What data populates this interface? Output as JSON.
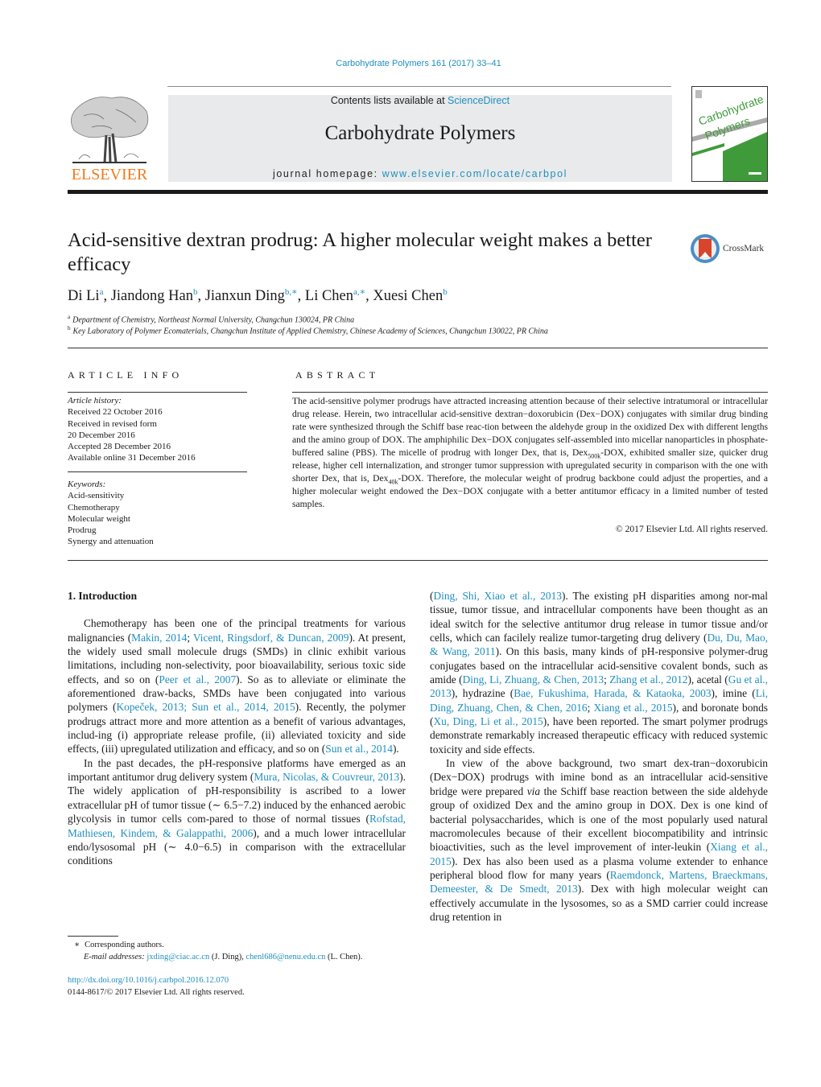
{
  "header": {
    "journal_ref": "Carbohydrate Polymers 161 (2017) 33–41",
    "contents_prefix": "Contents lists available at ",
    "contents_link": "ScienceDirect",
    "journal_name": "Carbohydrate Polymers",
    "homepage_prefix": "journal homepage: ",
    "homepage_link": "www.elsevier.com/locate/carbpol",
    "publisher_logo": "ELSEVIER",
    "cover": {
      "line1": "Carbohydrate",
      "line2": "Polymers"
    },
    "colors": {
      "link": "#1f8fbf",
      "elsevier_orange": "#f07b1a",
      "cover_green": "#3f9b3a",
      "banner_gray": "#e9eaeb"
    }
  },
  "title": "Acid-sensitive dextran prodrug: A higher molecular weight makes a better efficacy",
  "crossmark_label": "CrossMark",
  "authors": [
    {
      "name": "Di Li",
      "sup": "a"
    },
    {
      "name": "Jiandong Han",
      "sup": "b"
    },
    {
      "name": "Jianxun Ding",
      "sup": "b,∗"
    },
    {
      "name": "Li Chen",
      "sup": "a,∗"
    },
    {
      "name": "Xuesi Chen",
      "sup": "b"
    }
  ],
  "affiliations": [
    {
      "key": "a",
      "text": "Department of Chemistry, Northeast Normal University, Changchun 130024, PR China"
    },
    {
      "key": "b",
      "text": "Key Laboratory of Polymer Ecomaterials, Changchun Institute of Applied Chemistry, Chinese Academy of Sciences, Changchun 130022, PR China"
    }
  ],
  "article_info": {
    "heading": "ARTICLE INFO",
    "history_label": "Article history:",
    "history": [
      "Received 22 October 2016",
      "Received in revised form",
      "20 December 2016",
      "Accepted 28 December 2016",
      "Available online 31 December 2016"
    ],
    "keywords_label": "Keywords:",
    "keywords": [
      "Acid-sensitivity",
      "Chemotherapy",
      "Molecular weight",
      "Prodrug",
      "Synergy and attenuation"
    ]
  },
  "abstract": {
    "heading": "ABSTRACT",
    "part1": "The acid-sensitive polymer prodrugs have attracted increasing attention because of their selective intratumoral or intracellular drug release. Herein, two intracellular acid-sensitive dextran−doxorubicin (Dex−DOX) conjugates with similar drug binding rate were synthesized through the Schiff base reac-tion between the aldehyde group in the oxidized Dex with different lengths and the amino group of DOX. The amphiphilic Dex−DOX conjugates self-assembled into micellar nanoparticles in phosphate-buffered saline (PBS). The micelle of prodrug with longer Dex, that is, Dex",
    "sub1": "500k",
    "part2": "-DOX, exhibited smaller size, quicker drug release, higher cell internalization, and stronger tumor suppression with upregulated security in comparison with the one with shorter Dex, that is, Dex",
    "sub2": "40k",
    "part3": "-DOX. Therefore, the molecular weight of prodrug backbone could adjust the properties, and a higher molecular weight endowed the Dex−DOX conjugate with a better antitumor efficacy in a limited number of tested samples.",
    "copyright": "© 2017 Elsevier Ltd. All rights reserved."
  },
  "body": {
    "section_heading": "1.  Introduction",
    "p1": [
      {
        "t": "Chemotherapy has been one of the principal treatments for various malignancies ("
      },
      {
        "l": "Makin, 2014"
      },
      {
        "t": "; "
      },
      {
        "l": "Vicent, Ringsdorf, & Duncan, 2009"
      },
      {
        "t": "). At present, the widely used small molecule drugs (SMDs) in clinic exhibit various limitations, including non-selectivity, poor bioavailability, serious toxic side effects, and so on ("
      },
      {
        "l": "Peer et al., 2007"
      },
      {
        "t": "). So as to alleviate or eliminate the aforementioned draw-backs, SMDs have been conjugated into various polymers ("
      },
      {
        "l": "Kopeček, 2013; Sun et al., 2014, 2015"
      },
      {
        "t": "). Recently, the polymer prodrugs attract more and more attention as a benefit of various advantages, includ-ing (i) appropriate release profile, (ii) alleviated toxicity and side effects, (iii) upregulated utilization and efficacy, and so on ("
      },
      {
        "l": "Sun et al., 2014"
      },
      {
        "t": ")."
      }
    ],
    "p2": [
      {
        "t": "In the past decades, the pH-responsive platforms have emerged as an important antitumor drug delivery system ("
      },
      {
        "l": "Mura, Nicolas, & Couvreur, 2013"
      },
      {
        "t": "). The widely application of pH-responsibility is ascribed to a lower extracellular pH of tumor tissue (∼ 6.5−7.2) induced by the enhanced aerobic glycolysis in tumor cells com-pared to those of normal tissues ("
      },
      {
        "l": "Rofstad, Mathiesen, Kindem, & Galappathi, 2006"
      },
      {
        "t": "), and a much lower intracellular endo/lysosomal pH (∼ 4.0−6.5) in comparison with the extracellular conditions"
      }
    ],
    "p3": [
      {
        "t": "("
      },
      {
        "l": "Ding, Shi, Xiao et al., 2013"
      },
      {
        "t": "). The existing pH disparities among nor-mal tissue, tumor tissue, and intracellular components have been thought as an ideal switch for the selective antitumor drug release in tumor tissue and/or cells, which can facilely realize tumor-targeting drug delivery ("
      },
      {
        "l": "Du, Du, Mao, & Wang, 2011"
      },
      {
        "t": "). On this basis, many kinds of pH-responsive polymer-drug conjugates based on the intracellular acid-sensitive covalent bonds, such as amide ("
      },
      {
        "l": "Ding, Li, Zhuang, & Chen, 2013"
      },
      {
        "t": "; "
      },
      {
        "l": "Zhang et al., 2012"
      },
      {
        "t": "), acetal ("
      },
      {
        "l": "Gu et al., 2013"
      },
      {
        "t": "), hydrazine ("
      },
      {
        "l": "Bae, Fukushima, Harada, & Kataoka, 2003"
      },
      {
        "t": "), imine ("
      },
      {
        "l": "Li, Ding, Zhuang, Chen, & Chen, 2016"
      },
      {
        "t": "; "
      },
      {
        "l": "Xiang et al., 2015"
      },
      {
        "t": "), and boronate bonds ("
      },
      {
        "l": "Xu, Ding, Li et al., 2015"
      },
      {
        "t": "), have been reported. The smart polymer prodrugs demonstrate remarkably increased therapeutic efficacy with reduced systemic toxicity and side effects."
      }
    ],
    "p4": [
      {
        "t": "In view of the above background, two smart dex-tran−doxorubicin (Dex−DOX) prodrugs with imine bond as an intracellular acid-sensitive bridge were prepared "
      },
      {
        "i": "via"
      },
      {
        "t": " the Schiff base reaction between the side aldehyde group of oxidized Dex and the amino group in DOX. Dex is one kind of bacterial polysaccharides, which is one of the most popularly used natural macromolecules because of their excellent biocompatibility and intrinsic bioactivities, such as the level improvement of inter-leukin ("
      },
      {
        "l": "Xiang et al., 2015"
      },
      {
        "t": "). Dex has also been used as a plasma volume extender to enhance peripheral blood flow for many years ("
      },
      {
        "l": "Raemdonck, Martens, Braeckmans, Demeester, & De Smedt, 2013"
      },
      {
        "t": "). Dex with high molecular weight can effectively accumulate in the lysosomes, so as a SMD carrier could increase drug retention in"
      }
    ]
  },
  "footnote": {
    "star": "∗",
    "corresponding": "Corresponding authors.",
    "email_label": "E-mail addresses:",
    "email1": "jxding@ciac.ac.cn",
    "email1_owner": " (J. Ding), ",
    "email2": "chenl686@nenu.edu.cn",
    "email2_owner": " (L. Chen)."
  },
  "doi": {
    "link": "http://dx.doi.org/10.1016/j.carbpol.2016.12.070",
    "issn_line": "0144-8617/© 2017 Elsevier Ltd. All rights reserved."
  }
}
